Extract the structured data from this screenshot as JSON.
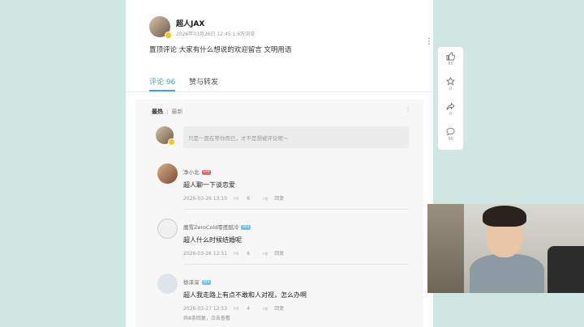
{
  "post": {
    "author": "超人JAX",
    "meta": "2026年03月26日 12:45 1.6万浏览",
    "more_icon": "more-vertical-icon",
    "text": "置顶评论 大家有什么想说的欢迎留言 文明用语"
  },
  "tabs": [
    {
      "label": "评论 96",
      "active": true
    },
    {
      "label": "赞与转发",
      "active": false
    }
  ],
  "sort": {
    "hot": "最热",
    "new": "最新"
  },
  "input": {
    "placeholder": "只是一面在等你而已，才不是想被评论呢～"
  },
  "comments": [
    {
      "name": "净小北",
      "level": "LV6",
      "text": "超人聊一下谈恋爱",
      "time": "2026-03-26 13:10",
      "likes": "6",
      "reply_label": "回复"
    },
    {
      "name": "魔雪ZeroCold零度酷冷",
      "level": "LV3",
      "text": "超人什么时候结婚呢",
      "time": "2026-03-26 12:51",
      "likes": "6",
      "reply_label": "回复"
    },
    {
      "name": "徐泽深",
      "level": "LV3",
      "text": "超人我走路上有点不敢和人对视，怎么办啊",
      "time": "2026-03-27 12:53",
      "likes": "4",
      "reply_label": "回复",
      "replies": "共8条回复，点击查看"
    }
  ],
  "side": {
    "like_count": "85",
    "fav_count": "0",
    "share_count": "0",
    "comment_count": "96"
  },
  "colors": {
    "accent": "#3ba4e0",
    "background": "#cfe6e3",
    "level_red": "#f25d5d",
    "level_blue": "#6cc4ef"
  }
}
